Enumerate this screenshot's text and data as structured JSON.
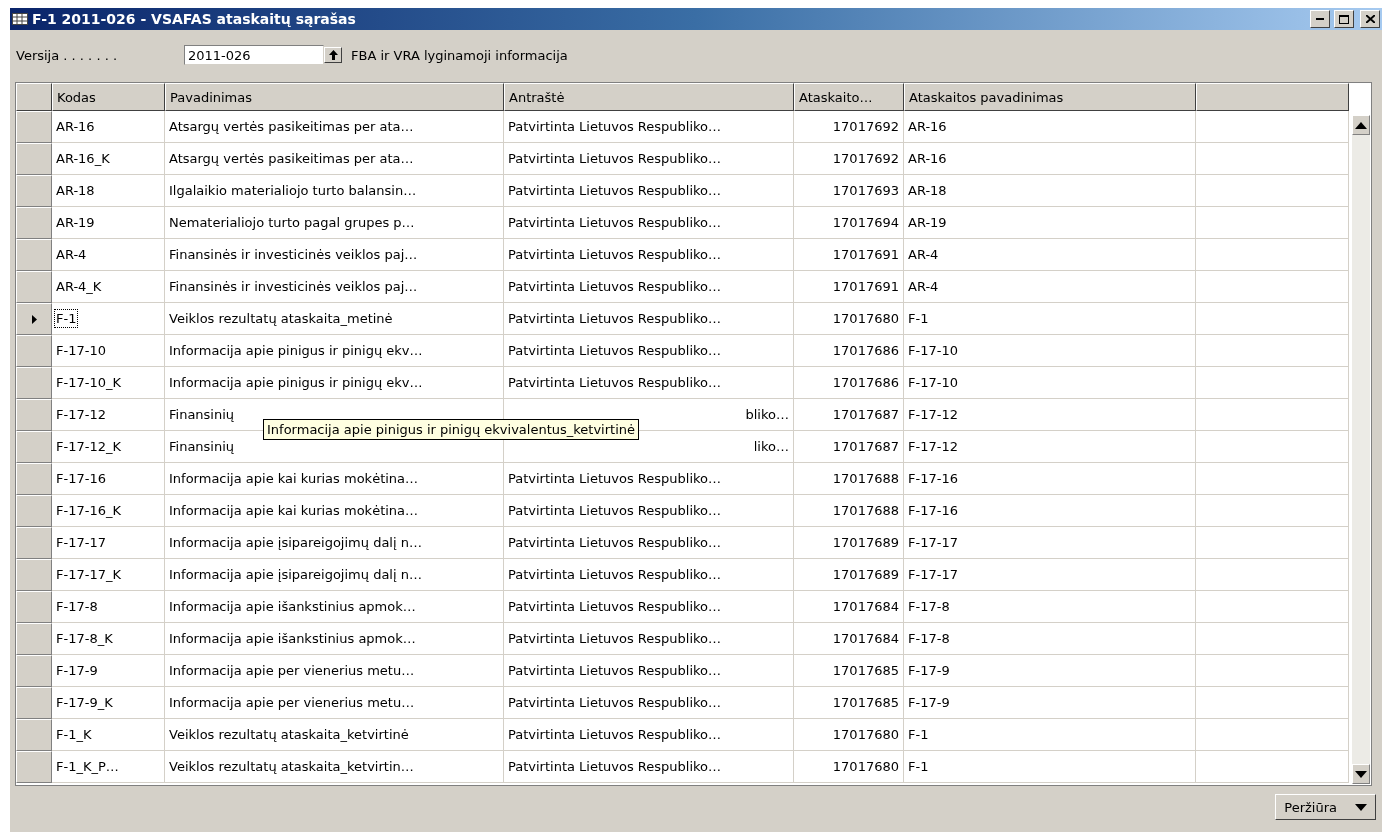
{
  "window": {
    "title": "F-1 2011-026 - VSAFAS ataskaitų sąrašas"
  },
  "filter": {
    "label": "Versija . . . . . . .",
    "value": "2011-026",
    "description": "FBA ir VRA lyginamoji informacija"
  },
  "table": {
    "columns": [
      "Kodas",
      "Pavadinimas",
      "Antraštė",
      "Ataskaito…",
      "Ataskaitos pavadinimas"
    ],
    "rows": [
      {
        "selected": false,
        "cells": [
          "AR-16",
          "Atsargų vertės pasikeitimas per ata…",
          "Patvirtinta Lietuvos Respubliko…",
          "17017692",
          "AR-16"
        ]
      },
      {
        "selected": false,
        "cells": [
          "AR-16_K",
          "Atsargų vertės pasikeitimas per ata…",
          "Patvirtinta Lietuvos Respubliko…",
          "17017692",
          "AR-16"
        ]
      },
      {
        "selected": false,
        "cells": [
          "AR-18",
          "Ilgalaikio materialiojo turto balansin…",
          "Patvirtinta Lietuvos Respubliko…",
          "17017693",
          "AR-18"
        ]
      },
      {
        "selected": false,
        "cells": [
          "AR-19",
          "Nematerialiojo turto pagal grupes p…",
          "Patvirtinta Lietuvos Respubliko…",
          "17017694",
          "AR-19"
        ]
      },
      {
        "selected": false,
        "cells": [
          "AR-4",
          "Finansinės ir investicinės veiklos paj…",
          "Patvirtinta Lietuvos Respubliko…",
          "17017691",
          "AR-4"
        ]
      },
      {
        "selected": false,
        "cells": [
          "AR-4_K",
          "Finansinės ir investicinės veiklos paj…",
          "Patvirtinta Lietuvos Respubliko…",
          "17017691",
          "AR-4"
        ]
      },
      {
        "selected": true,
        "cells": [
          "F-1",
          "Veiklos rezultatų ataskaita_metinė",
          "Patvirtinta Lietuvos Respubliko…",
          "17017680",
          "F-1"
        ]
      },
      {
        "selected": false,
        "cells": [
          "F-17-10",
          "Informacija apie pinigus ir pinigų ekv…",
          "Patvirtinta Lietuvos Respubliko…",
          "17017686",
          "F-17-10"
        ]
      },
      {
        "selected": false,
        "cells": [
          "F-17-10_K",
          "Informacija apie pinigus ir pinigų ekv…",
          "Patvirtinta Lietuvos Respubliko…",
          "17017686",
          "F-17-10"
        ]
      },
      {
        "selected": false,
        "covered": true,
        "cells": [
          "F-17-12",
          "Finansinių",
          "bliko…",
          "17017687",
          "F-17-12"
        ]
      },
      {
        "selected": false,
        "covered": true,
        "cells": [
          "F-17-12_K",
          "Finansinių",
          "liko…",
          "17017687",
          "F-17-12"
        ]
      },
      {
        "selected": false,
        "cells": [
          "F-17-16",
          "Informacija apie kai kurias mokėtina…",
          "Patvirtinta Lietuvos Respubliko…",
          "17017688",
          "F-17-16"
        ]
      },
      {
        "selected": false,
        "cells": [
          "F-17-16_K",
          "Informacija apie kai kurias mokėtina…",
          "Patvirtinta Lietuvos Respubliko…",
          "17017688",
          "F-17-16"
        ]
      },
      {
        "selected": false,
        "cells": [
          "F-17-17",
          "Informacija apie įsipareigojimų dalį n…",
          "Patvirtinta Lietuvos Respubliko…",
          "17017689",
          "F-17-17"
        ]
      },
      {
        "selected": false,
        "cells": [
          "F-17-17_K",
          "Informacija apie įsipareigojimų dalį n…",
          "Patvirtinta Lietuvos Respubliko…",
          "17017689",
          "F-17-17"
        ]
      },
      {
        "selected": false,
        "cells": [
          "F-17-8",
          "Informacija apie išankstinius apmok…",
          "Patvirtinta Lietuvos Respubliko…",
          "17017684",
          "F-17-8"
        ]
      },
      {
        "selected": false,
        "cells": [
          "F-17-8_K",
          "Informacija apie išankstinius apmok…",
          "Patvirtinta Lietuvos Respubliko…",
          "17017684",
          "F-17-8"
        ]
      },
      {
        "selected": false,
        "cells": [
          "F-17-9",
          "Informacija apie per vienerius metu…",
          "Patvirtinta Lietuvos Respubliko…",
          "17017685",
          "F-17-9"
        ]
      },
      {
        "selected": false,
        "cells": [
          "F-17-9_K",
          "Informacija apie per vienerius metu…",
          "Patvirtinta Lietuvos Respubliko…",
          "17017685",
          "F-17-9"
        ]
      },
      {
        "selected": false,
        "cells": [
          "F-1_K",
          "Veiklos rezultatų ataskaita_ketvirtinė",
          "Patvirtinta Lietuvos Respubliko…",
          "17017680",
          "F-1"
        ]
      },
      {
        "selected": false,
        "cells": [
          "F-1_K_P…",
          "Veiklos rezultatų ataskaita_ketvirtin…",
          "Patvirtinta Lietuvos Respubliko…",
          "17017680",
          "F-1"
        ]
      }
    ]
  },
  "tooltip": {
    "text": "Informacija apie pinigus ir pinigų ekvivalentus_ketvirtinė"
  },
  "buttons": [
    {
      "label": "Peržiūra"
    }
  ]
}
